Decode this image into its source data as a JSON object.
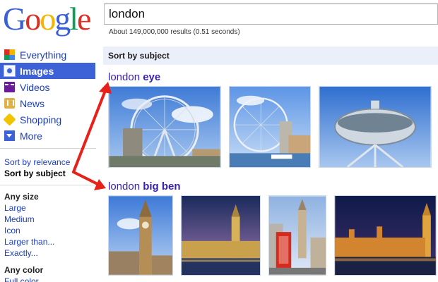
{
  "logo": {
    "text": "Google",
    "colors": [
      "#3b5fd7",
      "#d93025",
      "#f4b400",
      "#3b5fd7",
      "#0f9d58",
      "#d93025"
    ]
  },
  "search": {
    "query": "london"
  },
  "stats": {
    "text": "About 149,000,000 results (0.51 seconds)"
  },
  "nav": {
    "items": [
      {
        "label": "Everything",
        "icon": "everything-icon"
      },
      {
        "label": "Images",
        "icon": "images-icon"
      },
      {
        "label": "Videos",
        "icon": "videos-icon"
      },
      {
        "label": "News",
        "icon": "news-icon"
      },
      {
        "label": "Shopping",
        "icon": "shopping-icon"
      },
      {
        "label": "More",
        "icon": "more-icon"
      }
    ],
    "selected": "Images"
  },
  "sort": {
    "relevance": "Sort by relevance",
    "subject": "Sort by subject"
  },
  "filters": {
    "size": {
      "title": "Any size",
      "options": [
        "Large",
        "Medium",
        "Icon",
        "Larger than...",
        "Exactly..."
      ]
    },
    "color": {
      "title": "Any color",
      "options": [
        "Full color"
      ]
    }
  },
  "main": {
    "sort_header": "Sort by subject",
    "groups": [
      {
        "query": "london",
        "subject": "eye"
      },
      {
        "query": "london",
        "subject": "big ben"
      }
    ]
  },
  "colors": {
    "link": "#1a3dc1",
    "selected_nav": "#3d61d6",
    "arrow": "#e8201a",
    "group_title": "#3a1fb5"
  }
}
